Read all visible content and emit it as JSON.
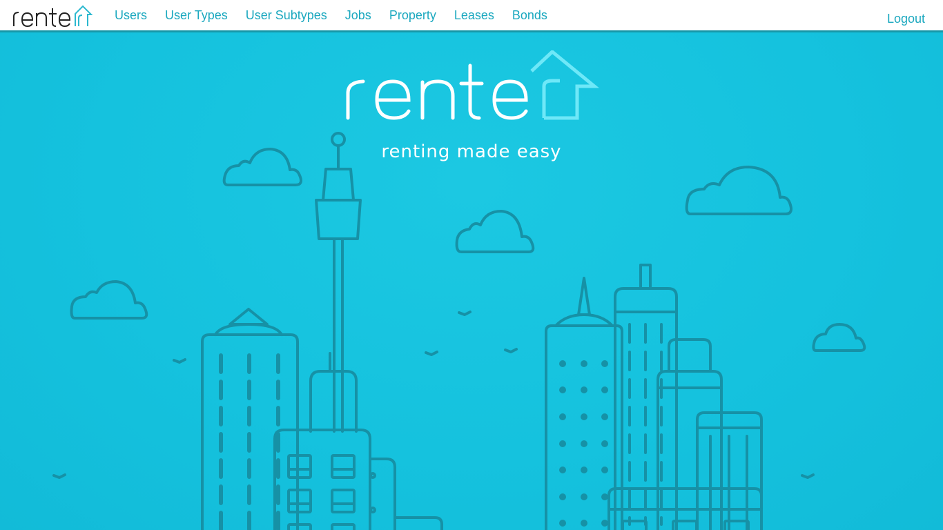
{
  "navbar": {
    "brand": "renter",
    "links": [
      {
        "label": "Users"
      },
      {
        "label": "User Types"
      },
      {
        "label": "User Subtypes"
      },
      {
        "label": "Jobs"
      },
      {
        "label": "Property"
      },
      {
        "label": "Leases"
      },
      {
        "label": "Bonds"
      }
    ],
    "logout_label": "Logout"
  },
  "hero": {
    "logo_text": "renter",
    "tagline": "renting made easy"
  },
  "colors": {
    "brand_teal": "#1797a8",
    "link": "#1ba8bf",
    "hero_bg": "#15c2de",
    "line_art": "#1691a6",
    "logo_house": "#6ee8f8"
  }
}
